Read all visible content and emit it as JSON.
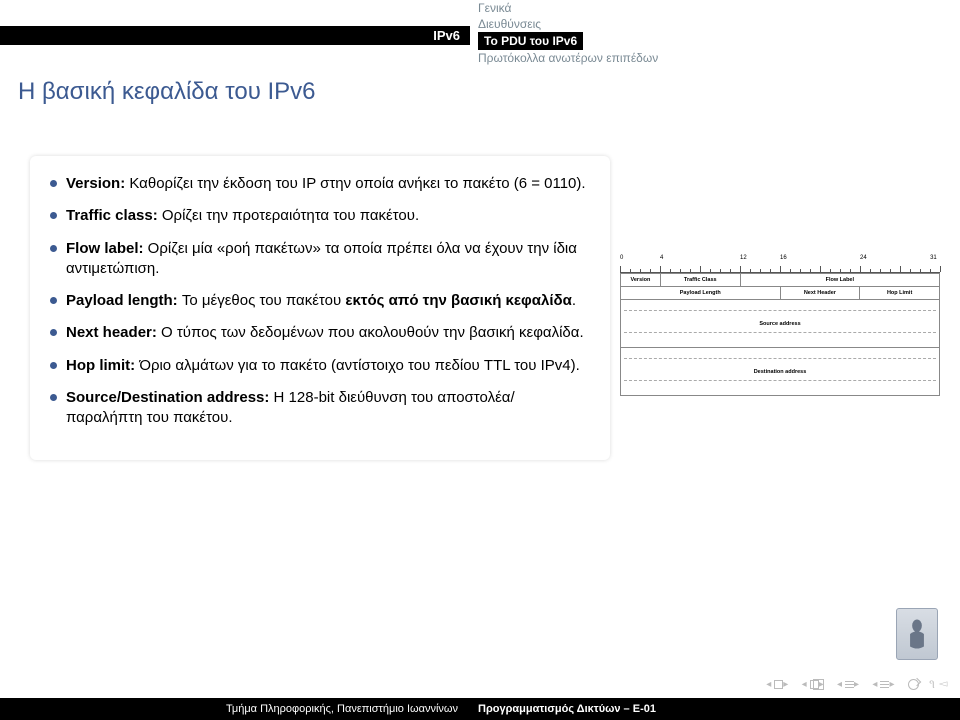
{
  "topbar": {
    "section_label": "IPv6",
    "items": [
      "Γενικά",
      "Διευθύνσεις",
      "Το PDU του IPv6",
      "Πρωτόκολλα ανωτέρων επιπέδων"
    ],
    "active_index": 2
  },
  "slide_title": "Η βασική κεφαλίδα του IPv6",
  "bullets": {
    "b0": {
      "label": "Version:",
      "text": " Καθορίζει την έκδοση του IP στην οποία ανήκει το πακέτο (6 = 0110)."
    },
    "b1": {
      "label": "Traffic class:",
      "text": " Ορίζει την προτεραιότητα του πακέτου."
    },
    "b2": {
      "label": "Flow label:",
      "text": " Ορίζει μία «ροή πακέτων» τα οποία πρέπει όλα να έχουν την ίδια αντιμετώπιση."
    },
    "b3": {
      "label": "Payload length:",
      "text_pre": " Το μέγεθος του πακέτου ",
      "strong": "εκτός από την βασική κεφαλίδα",
      "text_post": "."
    },
    "b4": {
      "label": "Next header:",
      "text": " Ο τύπος των δεδομένων που ακολουθούν την βασική κεφαλίδα."
    },
    "b5": {
      "label": "Hop limit:",
      "text": " Όριο αλμάτων για το πακέτο (αντίστοιχο του πεδίου TTL του IPv4)."
    },
    "b6": {
      "label": "Source/Destination address:",
      "text": " Η 128-bit διεύθυνση του αποστολέα/παραλήπτη του πακέτου."
    }
  },
  "diagram": {
    "bit_positions": [
      "0",
      "4",
      "12",
      "16",
      "24",
      "31"
    ],
    "row1": {
      "version": "Version",
      "tc": "Traffic Class",
      "flow": "Flow Label"
    },
    "row2": {
      "plen": "Payload Length",
      "nh": "Next Header",
      "hl": "Hop Limit"
    },
    "src": "Source address",
    "dst": "Destination address"
  },
  "footer": {
    "left": "Τμήμα Πληροφορικής, Πανεπιστήμιο Ιωαννίνων",
    "right": "Προγραμματισμός Δικτύων – E-01"
  }
}
